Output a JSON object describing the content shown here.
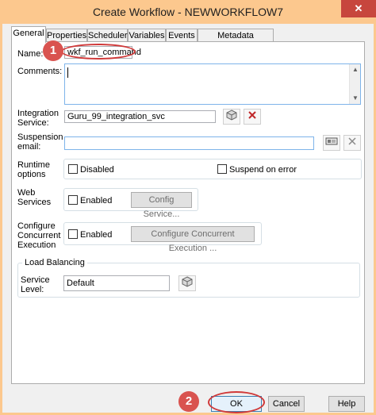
{
  "window": {
    "title": "Create Workflow - NEWWORKFLOW7",
    "close_glyph": "✕"
  },
  "tabs": [
    {
      "label": "General"
    },
    {
      "label": "Properties"
    },
    {
      "label": "Scheduler"
    },
    {
      "label": "Variables"
    },
    {
      "label": "Events"
    },
    {
      "label": "Metadata Extensions"
    }
  ],
  "form": {
    "name_label": "Name:",
    "name_value": "wkf_run_command",
    "comments_label": "Comments:",
    "comments_value": "",
    "integration_service_label_1": "Integration",
    "integration_service_label_2": "Service:",
    "integration_service_value": "Guru_99_integration_svc",
    "suspension_email_label_1": "Suspension",
    "suspension_email_label_2": "email:",
    "suspension_email_value": "",
    "runtime_options_label_1": "Runtime",
    "runtime_options_label_2": "options",
    "disabled_label": "Disabled",
    "suspend_on_error_label": "Suspend on error",
    "web_services_label_1": "Web",
    "web_services_label_2": "Services",
    "web_enabled_label": "Enabled",
    "config_service_label": "Config Service...",
    "concurrent_label_1": "Configure",
    "concurrent_label_2": "Concurrent",
    "concurrent_label_3": "Execution",
    "concurrent_enabled_label": "Enabled",
    "configure_concurrent_label": "Configure Concurrent Execution ...",
    "load_balancing_label": "Load Balancing",
    "service_level_label_1": "Service",
    "service_level_label_2": "Level:",
    "service_level_value": "Default"
  },
  "buttons": {
    "ok": "OK",
    "cancel": "Cancel",
    "help": "Help"
  },
  "annotations": {
    "marker_1": "1",
    "marker_2": "2"
  },
  "colors": {
    "titlebar": "#fcc88e",
    "close_button": "#c7463d",
    "annotation_red": "#d9534f",
    "delete_x": "#c0282a"
  },
  "icons": {
    "browse_service": "cube-icon",
    "delete_service": "red-x-icon",
    "email_edit": "email-card-icon",
    "email_clear": "gray-x-icon",
    "service_level_browse": "cube-icon"
  }
}
